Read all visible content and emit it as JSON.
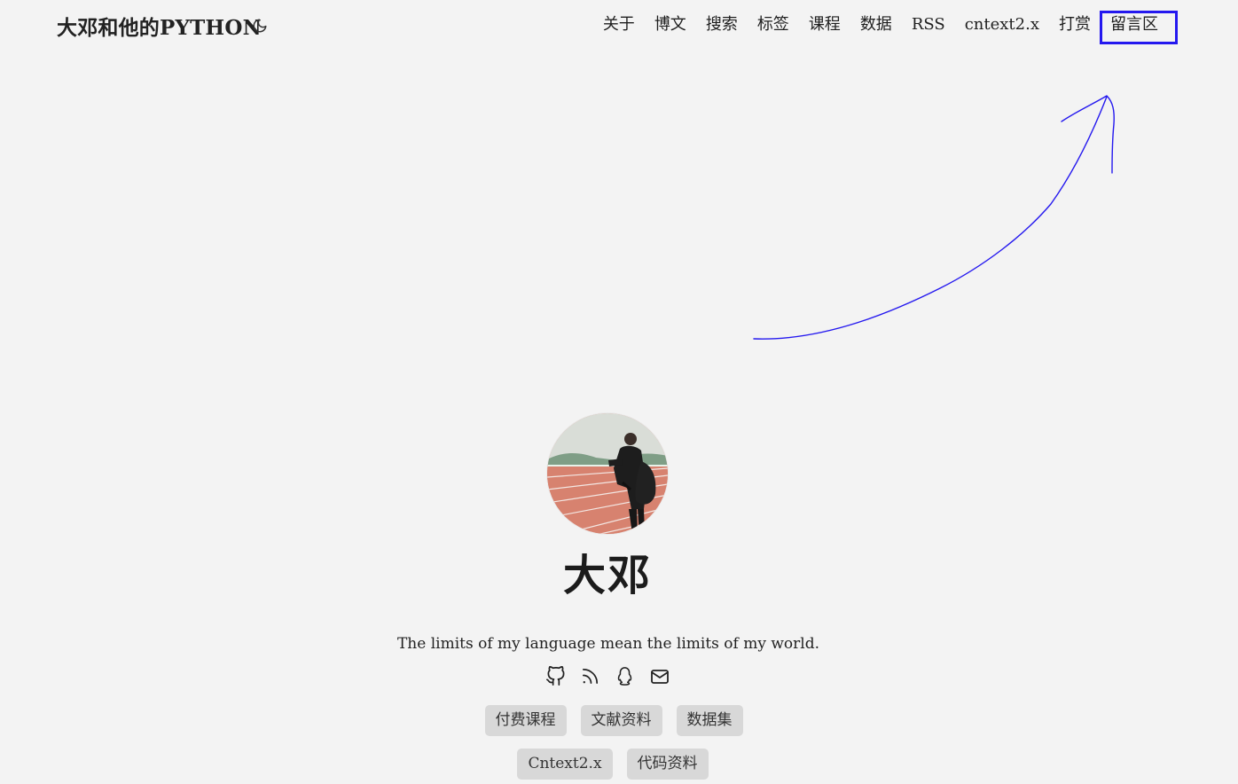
{
  "header": {
    "site_title": "大邓和他的PYTHON",
    "theme_toggle_icon": "moon-icon"
  },
  "nav": [
    {
      "label": "关于"
    },
    {
      "label": "博文"
    },
    {
      "label": "搜索"
    },
    {
      "label": "标签"
    },
    {
      "label": "课程"
    },
    {
      "label": "数据"
    },
    {
      "label": "RSS"
    },
    {
      "label": "cntext2.x"
    },
    {
      "label": "打赏"
    },
    {
      "label": "留言区"
    }
  ],
  "profile": {
    "name": "大邓",
    "motto": "The limits of my language mean the limits of my world.",
    "social_icons": [
      "github-icon",
      "rss-icon",
      "qq-icon",
      "mail-icon"
    ]
  },
  "buttons_row1": [
    {
      "label": "付费课程"
    },
    {
      "label": "文献资料"
    },
    {
      "label": "数据集"
    }
  ],
  "buttons_row2": [
    {
      "label": "Cntext2.x"
    },
    {
      "label": "代码资料"
    }
  ],
  "colors": {
    "background": "#f3f3f3",
    "button_bg": "#d8d8d8",
    "annotation": "#2418ef"
  }
}
